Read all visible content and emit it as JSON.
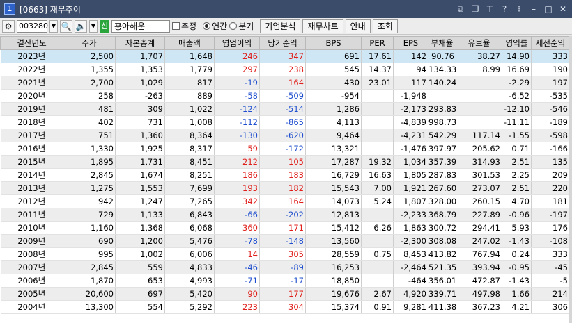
{
  "window": {
    "number": "1",
    "title": "[0663] 재무추이"
  },
  "toolbar": {
    "code": "003280",
    "badge": "신",
    "name": "흥아해운",
    "estimate_label": "추정",
    "annual_label": "연간",
    "quarter_label": "분기",
    "btn_analysis": "기업분석",
    "btn_chart": "재무차트",
    "btn_guide": "안내",
    "btn_search": "조회"
  },
  "table": {
    "headers": [
      "결산년도",
      "주가",
      "자본총계",
      "매출액",
      "영업이익",
      "당기순익",
      "BPS",
      "PER",
      "EPS",
      "부채율",
      "유보율",
      "영익률",
      "세전순익"
    ],
    "rows": [
      [
        "2023년",
        "2,500",
        "1,707",
        "1,648",
        "246",
        "347",
        "691",
        "17.61",
        "142",
        "90.76",
        "38.27",
        "14.90",
        "333"
      ],
      [
        "2022년",
        "1,355",
        "1,353",
        "1,779",
        "297",
        "238",
        "545",
        "14.37",
        "94",
        "134.33",
        "8.99",
        "16.69",
        "190"
      ],
      [
        "2021년",
        "2,700",
        "1,029",
        "817",
        "-19",
        "164",
        "430",
        "23.01",
        "117",
        "140.24",
        "",
        "-2.29",
        "197"
      ],
      [
        "2020년",
        "258",
        "-263",
        "889",
        "-58",
        "-509",
        "-954",
        "",
        "-1,948",
        "",
        "",
        "-6.52",
        "-535"
      ],
      [
        "2019년",
        "481",
        "309",
        "1,022",
        "-124",
        "-514",
        "1,286",
        "",
        "-2,173",
        "293.83",
        "",
        "-12.10",
        "-546"
      ],
      [
        "2018년",
        "402",
        "731",
        "1,008",
        "-112",
        "-865",
        "4,113",
        "",
        "-4,839",
        "998.73",
        "",
        "-11.11",
        "-189"
      ],
      [
        "2017년",
        "751",
        "1,360",
        "8,364",
        "-130",
        "-620",
        "9,464",
        "",
        "-4,231",
        "542.29",
        "117.14",
        "-1.55",
        "-598"
      ],
      [
        "2016년",
        "1,330",
        "1,925",
        "8,317",
        "59",
        "-172",
        "13,321",
        "",
        "-1,476",
        "397.97",
        "205.62",
        "0.71",
        "-166"
      ],
      [
        "2015년",
        "1,895",
        "1,731",
        "8,451",
        "212",
        "105",
        "17,287",
        "19.32",
        "1,034",
        "357.39",
        "314.93",
        "2.51",
        "135"
      ],
      [
        "2014년",
        "2,845",
        "1,674",
        "8,251",
        "186",
        "183",
        "16,729",
        "16.63",
        "1,805",
        "287.83",
        "301.53",
        "2.25",
        "209"
      ],
      [
        "2013년",
        "1,275",
        "1,553",
        "7,699",
        "193",
        "182",
        "15,543",
        "7.00",
        "1,921",
        "267.60",
        "273.07",
        "2.51",
        "220"
      ],
      [
        "2012년",
        "942",
        "1,247",
        "7,265",
        "342",
        "164",
        "14,073",
        "5.24",
        "1,807",
        "328.00",
        "260.15",
        "4.70",
        "181"
      ],
      [
        "2011년",
        "729",
        "1,133",
        "6,843",
        "-66",
        "-202",
        "12,813",
        "",
        "-2,233",
        "368.79",
        "227.89",
        "-0.96",
        "-197"
      ],
      [
        "2010년",
        "1,160",
        "1,368",
        "6,068",
        "360",
        "171",
        "15,412",
        "6.26",
        "1,863",
        "300.72",
        "294.41",
        "5.93",
        "176"
      ],
      [
        "2009년",
        "690",
        "1,200",
        "5,476",
        "-78",
        "-148",
        "13,560",
        "",
        "-2,300",
        "308.08",
        "247.02",
        "-1.43",
        "-108"
      ],
      [
        "2008년",
        "995",
        "1,002",
        "6,006",
        "14",
        "305",
        "28,559",
        "0.75",
        "8,453",
        "413.82",
        "767.94",
        "0.24",
        "333"
      ],
      [
        "2007년",
        "2,845",
        "559",
        "4,833",
        "-46",
        "-89",
        "16,253",
        "",
        "-2,464",
        "521.35",
        "393.94",
        "-0.95",
        "-45"
      ],
      [
        "2006년",
        "1,870",
        "653",
        "4,993",
        "-71",
        "-17",
        "18,850",
        "",
        "-464",
        "356.01",
        "472.87",
        "-1.43",
        "-5"
      ],
      [
        "2005년",
        "20,600",
        "697",
        "5,420",
        "90",
        "177",
        "19,676",
        "2.67",
        "4,920",
        "339.71",
        "497.98",
        "1.66",
        "214"
      ],
      [
        "2004년",
        "13,300",
        "554",
        "5,292",
        "223",
        "304",
        "15,374",
        "0.91",
        "9,281",
        "411.38",
        "367.23",
        "4.21",
        "306"
      ]
    ]
  },
  "colors": {
    "positive": "#e0201c",
    "negative": "#1f4fcf",
    "selected_row": "#cfe7f5"
  }
}
